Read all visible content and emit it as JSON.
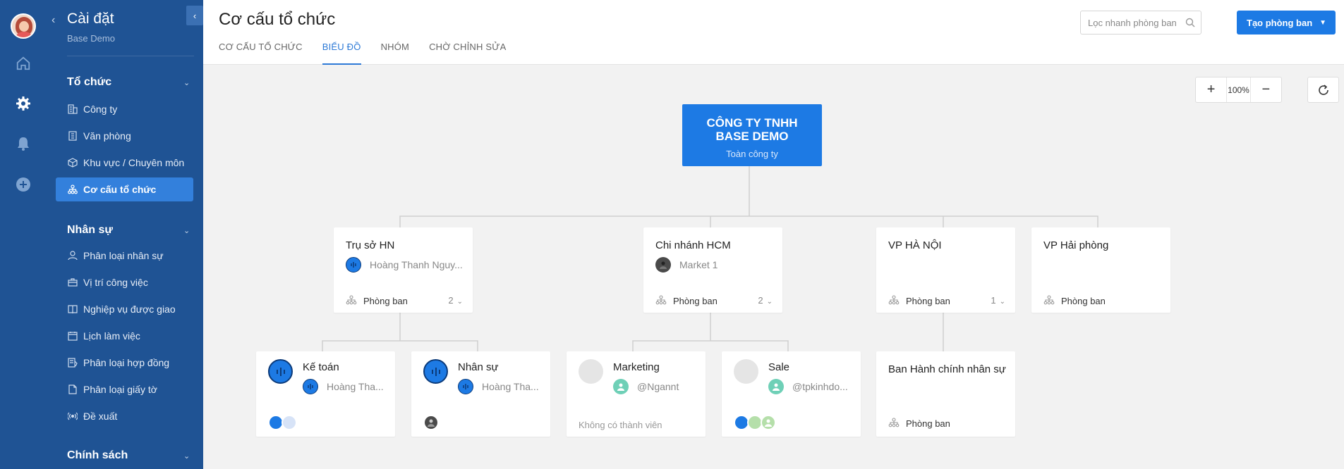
{
  "sidebar": {
    "title": "Cài đặt",
    "subtitle": "Base Demo",
    "sections": [
      {
        "label": "Tổ chức"
      },
      {
        "label": "Nhân sự"
      },
      {
        "label": "Chính sách"
      }
    ],
    "org_items": [
      {
        "label": "Công ty",
        "icon": "building-icon"
      },
      {
        "label": "Văn phòng",
        "icon": "office-icon"
      },
      {
        "label": "Khu vực / Chuyên môn",
        "icon": "cube-icon"
      },
      {
        "label": "Cơ cấu tổ chức",
        "icon": "org-chart-icon",
        "active": true
      }
    ],
    "hr_items": [
      {
        "label": "Phân loại nhân sự",
        "icon": "user-icon"
      },
      {
        "label": "Vị trí công việc",
        "icon": "briefcase-icon"
      },
      {
        "label": "Nghiệp vụ được giao",
        "icon": "book-icon"
      },
      {
        "label": "Lịch làm việc",
        "icon": "calendar-icon"
      },
      {
        "label": "Phân loại hợp đồng",
        "icon": "contract-icon"
      },
      {
        "label": "Phân loại giấy tờ",
        "icon": "document-icon"
      },
      {
        "label": "Đề xuất",
        "icon": "broadcast-icon"
      }
    ]
  },
  "header": {
    "title": "Cơ cấu tổ chức",
    "tabs": [
      {
        "label": "CƠ CẤU TỔ CHỨC"
      },
      {
        "label": "BIỂU ĐỒ",
        "active": true
      },
      {
        "label": "NHÓM"
      },
      {
        "label": "CHỜ CHỈNH SỬA"
      }
    ],
    "search_placeholder": "Lọc nhanh phòng ban",
    "create_button": "Tạo phòng ban"
  },
  "zoom": {
    "plus": "+",
    "value": "100%",
    "minus": "−"
  },
  "org": {
    "root": {
      "name_line1": "CÔNG TY TNHH",
      "name_line2": "BASE DEMO",
      "scope": "Toàn công ty"
    },
    "level1": [
      {
        "name": "Trụ sở HN",
        "member": "Hoàng Thanh Nguy...",
        "dept_label": "Phòng ban",
        "count": "2"
      },
      {
        "name": "Chi nhánh HCM",
        "member": "Market 1",
        "dept_label": "Phòng ban",
        "count": "2"
      },
      {
        "name": "VP HÀ NỘI",
        "dept_label": "Phòng ban",
        "count": "1"
      },
      {
        "name": "VP Hải phòng",
        "dept_label": "Phòng ban"
      }
    ],
    "level2": [
      {
        "name": "Kế toán",
        "member": "Hoàng Tha..."
      },
      {
        "name": "Nhân sự",
        "member": "Hoàng Tha..."
      },
      {
        "name": "Marketing",
        "member": "@Ngannt",
        "empty_text": "Không có thành viên"
      },
      {
        "name": "Sale",
        "member": "@tpkinhdo..."
      },
      {
        "name": "Ban Hành chính nhân sự",
        "dept_label": "Phòng ban"
      }
    ]
  }
}
